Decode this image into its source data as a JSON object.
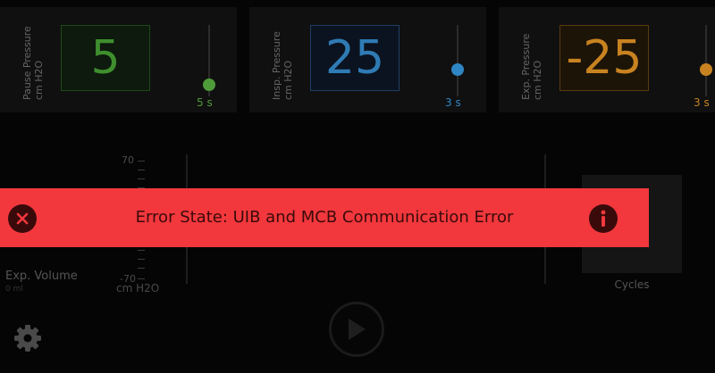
{
  "panels": [
    {
      "label": "Pause Pressure",
      "unit": "cm H2O",
      "value": "5",
      "seconds": "5 s",
      "color": "#3f8f2e",
      "bg": "#0d1a0d"
    },
    {
      "label": "Insp. Pressure",
      "unit": "cm H2O",
      "value": "25",
      "seconds": "3 s",
      "color": "#2f7bb4",
      "bg": "#0b1320"
    },
    {
      "label": "Exp. Pressure",
      "unit": "cm H2O",
      "value": "-25",
      "seconds": "3 s",
      "color": "#c88320",
      "bg": "#1d1408"
    }
  ],
  "gauge": {
    "top": "70",
    "bottom": "-70",
    "unit": "cm H2O"
  },
  "left": {
    "exp_volume": "Exp. Volume",
    "exp_volume_value": "0 ml"
  },
  "right": {
    "cycles": "Cycles"
  },
  "error": {
    "message": "Error State: UIB and MCB Communication Error",
    "color": "#f2383d"
  },
  "icons": {
    "settings": "gear-icon",
    "play": "play-icon",
    "dismiss": "close-icon",
    "info": "info-icon"
  }
}
